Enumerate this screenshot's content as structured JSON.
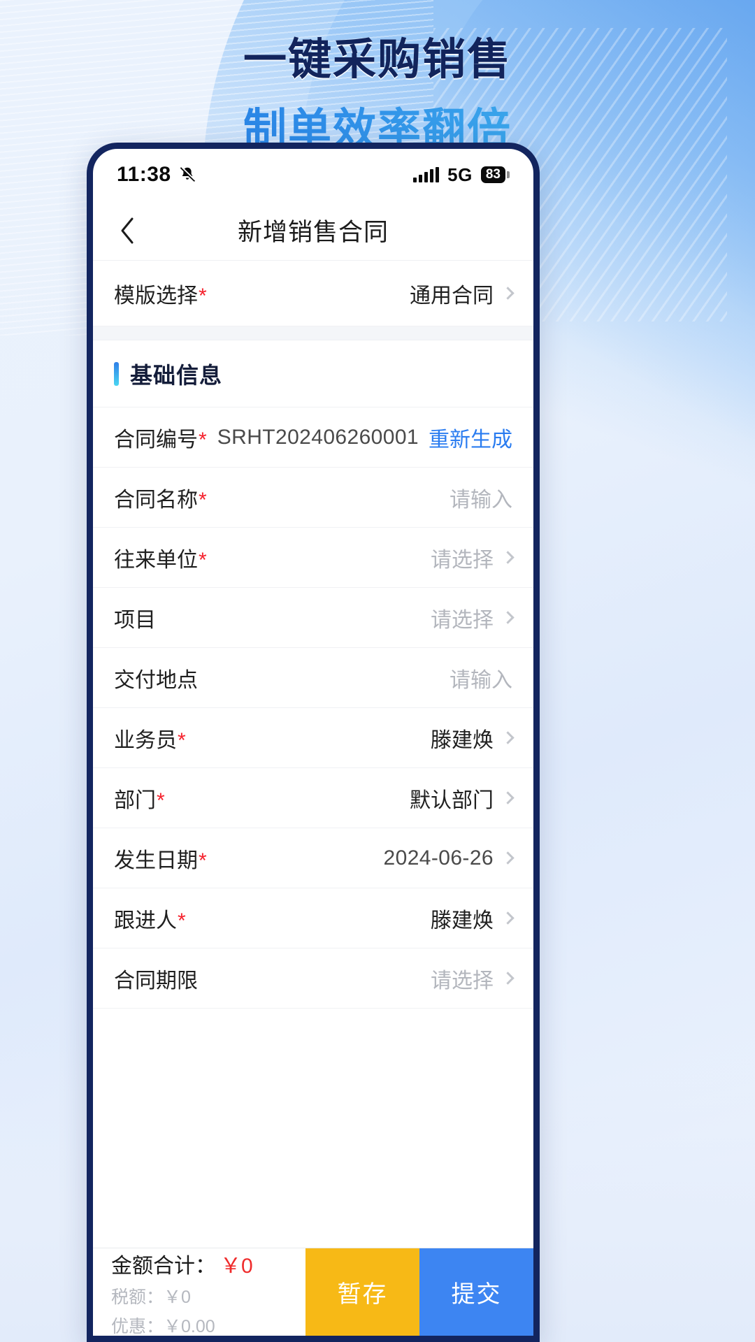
{
  "banner": {
    "line1": "一键采购销售",
    "line2": "制单效率翻倍",
    "line1_color": "#12245c",
    "line2_gradient_from": "#1f6fe0",
    "line2_gradient_to": "#49c3ee"
  },
  "status_bar": {
    "time": "11:38",
    "bell_icon": "bell-muted-icon",
    "signal_icon": "signal-bars-icon",
    "network": "5G",
    "battery": "83"
  },
  "navbar": {
    "back_icon": "chevron-left-icon",
    "title": "新增销售合同"
  },
  "template_row": {
    "label": "模版选择",
    "required": "*",
    "value": "通用合同",
    "chevron_icon": "chevron-right-icon"
  },
  "section": {
    "title": "基础信息"
  },
  "fields": [
    {
      "label": "合同编号",
      "required": "*",
      "value": "SRHT202406260001",
      "value_style": "mono",
      "link": "重新生成",
      "chevron": false
    },
    {
      "label": "合同名称",
      "required": "*",
      "value": "请输入",
      "value_style": "placeholder",
      "link": "",
      "chevron": false
    },
    {
      "label": "往来单位",
      "required": "*",
      "value": "请选择",
      "value_style": "placeholder",
      "link": "",
      "chevron": true
    },
    {
      "label": "项目",
      "required": "",
      "value": "请选择",
      "value_style": "placeholder",
      "link": "",
      "chevron": true
    },
    {
      "label": "交付地点",
      "required": "",
      "value": "请输入",
      "value_style": "placeholder",
      "link": "",
      "chevron": false
    },
    {
      "label": "业务员",
      "required": "*",
      "value": "滕建焕",
      "value_style": "",
      "link": "",
      "chevron": true
    },
    {
      "label": "部门",
      "required": "*",
      "value": "默认部门",
      "value_style": "",
      "link": "",
      "chevron": true
    },
    {
      "label": "发生日期",
      "required": "*",
      "value": "2024-06-26",
      "value_style": "mono",
      "link": "",
      "chevron": true
    },
    {
      "label": "跟进人",
      "required": "*",
      "value": "滕建焕",
      "value_style": "",
      "link": "",
      "chevron": true
    },
    {
      "label": "合同期限",
      "required": "",
      "value": "请选择",
      "value_style": "placeholder",
      "link": "",
      "chevron": true
    }
  ],
  "bottom_bar": {
    "total_label": "金额合计：",
    "total_amount": "￥0",
    "tax_line": "税额：￥0",
    "discount_line": "优惠：￥0.00",
    "hold_button": "暂存",
    "submit_button": "提交",
    "hold_color": "#f7b916",
    "submit_color": "#3d85f2",
    "amount_color": "#ef2b2b"
  }
}
